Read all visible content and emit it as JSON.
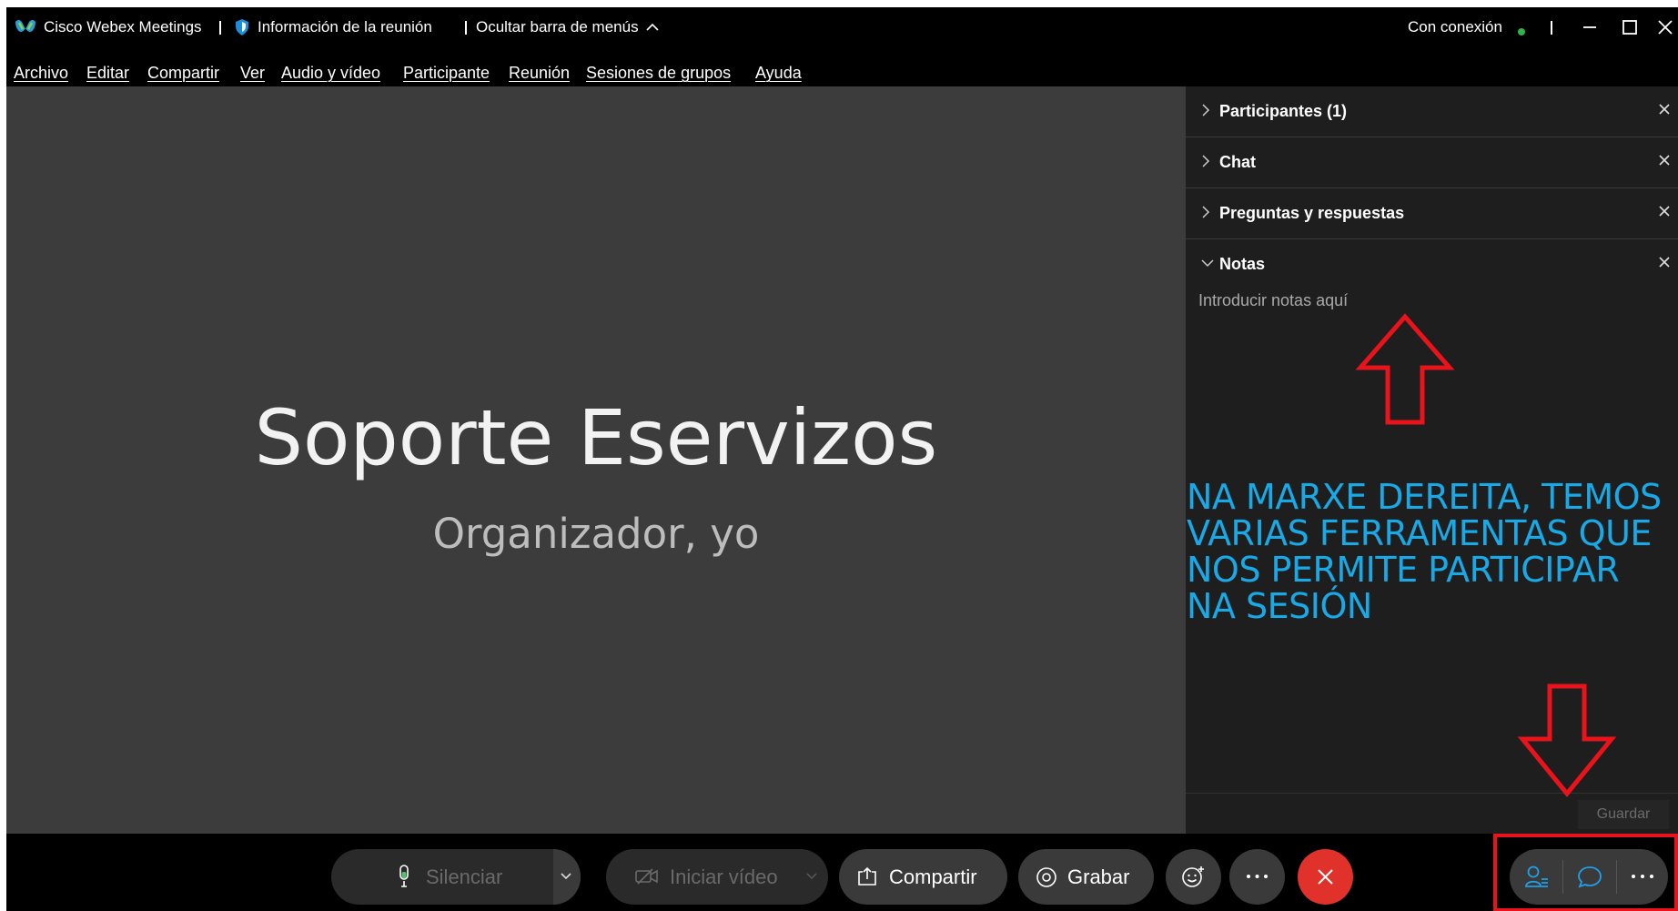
{
  "titlebar": {
    "app_name": "Cisco Webex Meetings",
    "meeting_info": "Información de la reunión",
    "hide_menu": "Ocultar barra de menús",
    "connection": "Con conexión"
  },
  "menu": [
    "Archivo",
    "Editar",
    "Compartir",
    "Ver",
    "Audio y vídeo",
    "Participante",
    "Reunión",
    "Sesiones de grupos",
    "Ayuda"
  ],
  "stage": {
    "title": "Soporte Eservizos",
    "subtitle": "Organizador, yo"
  },
  "panel": {
    "sections": [
      {
        "label": "Participantes (1)",
        "expanded": false
      },
      {
        "label": "Chat",
        "expanded": false
      },
      {
        "label": "Preguntas y respuestas",
        "expanded": false
      },
      {
        "label": "Notas",
        "expanded": true
      }
    ],
    "notes_placeholder": "Introducir notas aquí",
    "save_label": "Guardar"
  },
  "annotation": {
    "text": "NA MARXE DEREITA, TEMOS VARIAS FERRAMENTAS QUE NOS PERMITE PARTICIPAR NA SESIÓN",
    "color": "#18a9e6",
    "arrow_color": "#e8131b"
  },
  "controls": {
    "mute_label": "Silenciar",
    "video_label": "Iniciar vídeo",
    "share_label": "Compartir",
    "record_label": "Grabar",
    "end_color": "#e0322b",
    "accent": "#1fa0e8"
  }
}
